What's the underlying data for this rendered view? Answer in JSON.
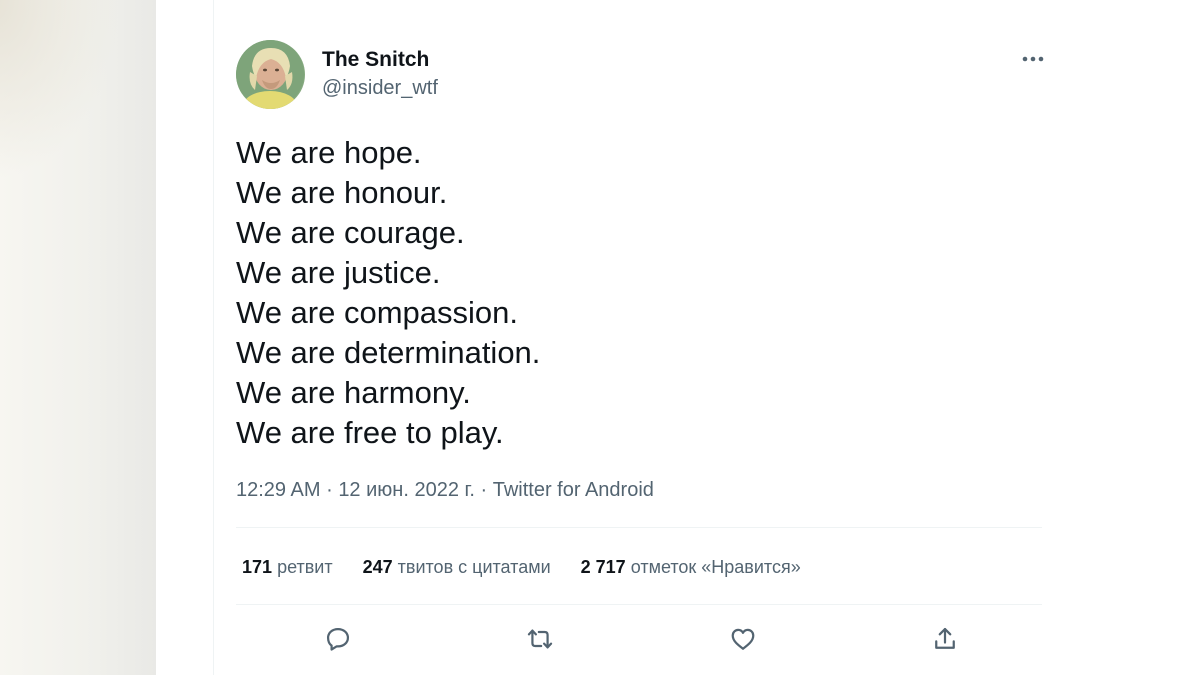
{
  "tweet": {
    "author": {
      "name": "The Snitch",
      "handle": "@insider_wtf"
    },
    "lines": [
      "We are hope.",
      "We are honour.",
      "We are courage.",
      "We are justice.",
      "We are compassion.",
      "We are determination.",
      "We are harmony.",
      "We are free to play."
    ],
    "time": "12:29 AM",
    "separator": "·",
    "date": "12 июн. 2022 г.",
    "source": "Twitter for Android"
  },
  "stats": {
    "retweets": {
      "count": "171",
      "label": "ретвит"
    },
    "quotes": {
      "count": "247",
      "label": "твитов с цитатами"
    },
    "likes": {
      "count": "2 717",
      "label": "отметок «Нравится»"
    }
  },
  "icons": {
    "more": "more-horizontal-icon",
    "reply": "reply-icon",
    "retweet": "retweet-icon",
    "like": "heart-icon",
    "share": "share-icon"
  },
  "colors": {
    "text": "#0f1419",
    "secondary": "#536471",
    "divider": "#eff3f4"
  }
}
